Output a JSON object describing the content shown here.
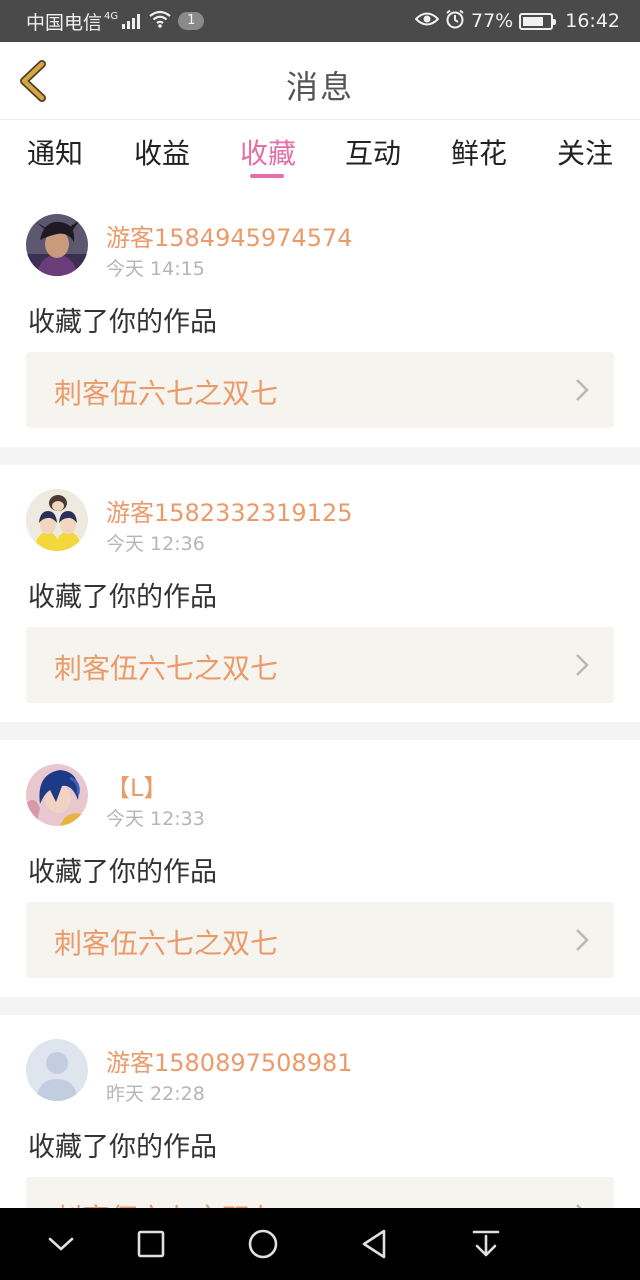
{
  "status_bar": {
    "carrier": "中国电信",
    "network": "4G",
    "notification_count": "1",
    "battery": "77%",
    "battery_level": 0.77,
    "time": "16:42"
  },
  "header": {
    "title": "消息"
  },
  "tabs": [
    {
      "label": "通知",
      "active": false
    },
    {
      "label": "收益",
      "active": false
    },
    {
      "label": "收藏",
      "active": true
    },
    {
      "label": "互动",
      "active": false
    },
    {
      "label": "鲜花",
      "active": false
    },
    {
      "label": "关注",
      "active": false
    }
  ],
  "notifications": [
    {
      "username": "游客1584945974574",
      "time": "今天 14:15",
      "action": "收藏了你的作品",
      "work_title": "刺客伍六七之双七",
      "avatar": "anime-boy-avatar"
    },
    {
      "username": "游客1582332319125",
      "time": "今天 12:36",
      "action": "收藏了你的作品",
      "work_title": "刺客伍六七之双七",
      "avatar": "anime-pair-avatar"
    },
    {
      "username": "【L】",
      "time": "今天 12:33",
      "action": "收藏了你的作品",
      "work_title": "刺客伍六七之双七",
      "avatar": "anime-blue-hair-avatar"
    },
    {
      "username": "游客1580897508981",
      "time": "昨天 22:28",
      "action": "收藏了你的作品",
      "work_title": "刺客伍六七之双七",
      "avatar": "default-user-avatar"
    }
  ],
  "colors": {
    "accent": "#e46fa8",
    "username": "#eb9a6a",
    "work_box_bg": "#f5f4ee",
    "back_icon": "#d9a63a"
  }
}
